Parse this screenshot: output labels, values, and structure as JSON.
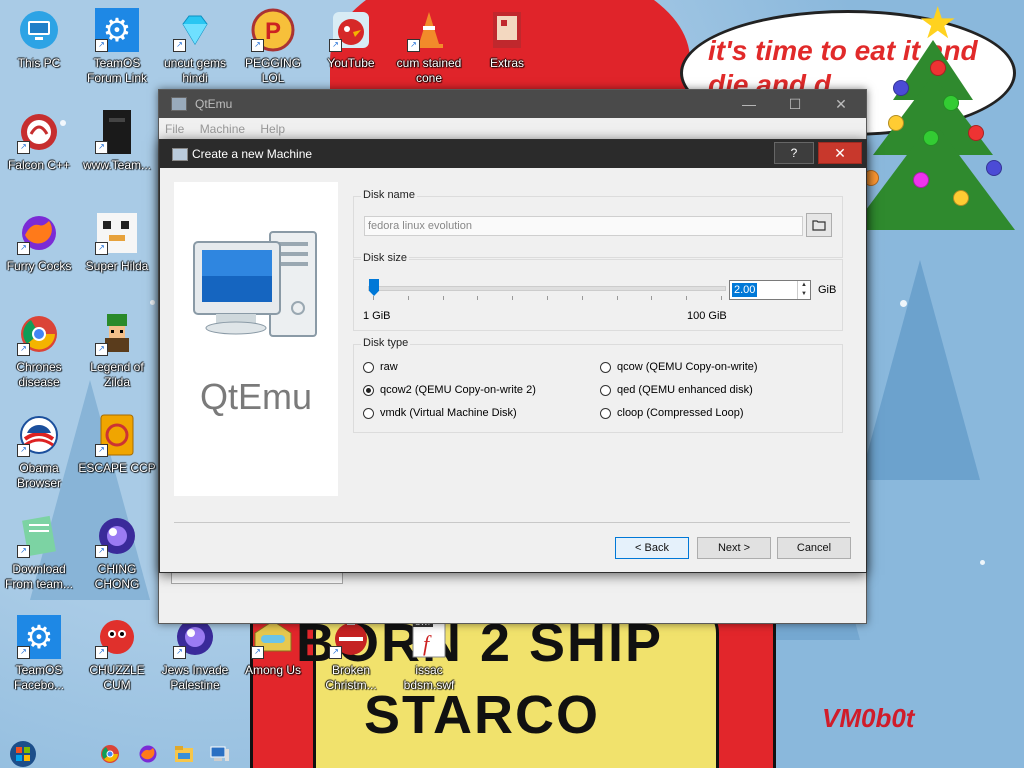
{
  "desktop": {
    "wallpaper": {
      "speech": "it's time to eat it and die and d",
      "bottom_text_line1": "BORN 2 SHIP",
      "bottom_text_line2": "STARCO",
      "signature": "VM0b0t"
    },
    "icons": [
      {
        "label": "This PC",
        "icon": "monitor-icon"
      },
      {
        "label": "TeamOS Forum Link",
        "icon": "gear-icon"
      },
      {
        "label": "uncut gems hindi",
        "icon": "diamond-icon"
      },
      {
        "label": "PEGGING LOL",
        "icon": "p-logo-icon"
      },
      {
        "label": "YouTube",
        "icon": "angry-bird-icon"
      },
      {
        "label": "cum stained cone",
        "icon": "cone-icon"
      },
      {
        "label": "Extras",
        "icon": "extras-icon"
      },
      {
        "label": "Falcon C++",
        "icon": "falcon-icon"
      },
      {
        "label": "www.Team...",
        "icon": "book-icon"
      },
      {
        "label": "Furry Cocks",
        "icon": "firefox-icon"
      },
      {
        "label": "Super Hilda",
        "icon": "pixel-cat-icon"
      },
      {
        "label": "Chrones disease",
        "icon": "chrome-icon"
      },
      {
        "label": "Legend of Zilda",
        "icon": "pixel-hero-icon"
      },
      {
        "label": "Obama Browser",
        "icon": "obama-logo-icon"
      },
      {
        "label": "ESCAPE CCP",
        "icon": "mahjong-icon"
      },
      {
        "label": "Download From team...",
        "icon": "notepad-icon"
      },
      {
        "label": "CHING CHONG",
        "icon": "orb-icon"
      },
      {
        "label": "TeamOS Facebo...",
        "icon": "gear-icon"
      },
      {
        "label": "CHUZZLE CUM",
        "icon": "chuzzle-icon"
      },
      {
        "label": "Jews Invade Palestine",
        "icon": "orb-icon"
      },
      {
        "label": "Among Us",
        "icon": "among-us-icon"
      },
      {
        "label": "Broken Christm...",
        "icon": "broken-ornament-icon"
      },
      {
        "label": "issac bdsm.swf",
        "icon": "flash-icon",
        "badge": "SWF"
      }
    ]
  },
  "taskbar": {
    "items": [
      "start-icon",
      "chrome-icon",
      "firefox-icon",
      "file-explorer-icon",
      "qtemu-icon"
    ]
  },
  "main_window": {
    "title": "QtEmu",
    "menu": [
      "File",
      "Machine",
      "Help"
    ]
  },
  "dialog": {
    "title": "Create a new Machine",
    "help_label": "?",
    "close_label": "✕",
    "brand": "QtEmu",
    "disk_name": {
      "label": "Disk name",
      "value": "fedora linux evolution"
    },
    "disk_size": {
      "label": "Disk size",
      "value": "2.00",
      "unit": "GiB",
      "min_label": "1 GiB",
      "max_label": "100 GiB",
      "slider_fraction": 0.0
    },
    "disk_type": {
      "label": "Disk type",
      "options": [
        {
          "label": "raw",
          "selected": false
        },
        {
          "label": "qcow (QEMU Copy-on-write)",
          "selected": false
        },
        {
          "label": "qcow2 (QEMU Copy-on-write 2)",
          "selected": true
        },
        {
          "label": "qed (QEMU enhanced disk)",
          "selected": false
        },
        {
          "label": "vmdk (Virtual Machine Disk)",
          "selected": false
        },
        {
          "label": "cloop (Compressed Loop)",
          "selected": false
        }
      ]
    },
    "buttons": {
      "back": "< Back",
      "next": "Next >",
      "cancel": "Cancel"
    }
  }
}
